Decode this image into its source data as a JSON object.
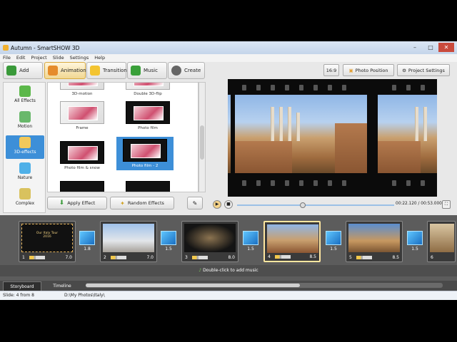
{
  "window": {
    "title": "Autumn - SmartSHOW 3D",
    "controls": [
      "–",
      "□",
      "✕"
    ]
  },
  "menu": [
    "File",
    "Edit",
    "Project",
    "Slide",
    "Settings",
    "Help"
  ],
  "tabs": [
    {
      "label": "Add",
      "icon": "add-icon"
    },
    {
      "label": "Animation",
      "icon": "animation-icon",
      "active": true
    },
    {
      "label": "Transitions",
      "icon": "star-icon"
    },
    {
      "label": "Music",
      "icon": "music-note-icon"
    },
    {
      "label": "Create",
      "icon": "film-reel-icon"
    }
  ],
  "categories": [
    {
      "label": "All Effects",
      "icon": "puzzle-icon"
    },
    {
      "label": "Motion",
      "icon": "move-arrows-icon"
    },
    {
      "label": "3D-effects",
      "icon": "cube-icon",
      "active": true
    },
    {
      "label": "Nature",
      "icon": "snowflake-icon"
    },
    {
      "label": "Complex",
      "icon": "layers-icon"
    }
  ],
  "effects": [
    {
      "label": "3D-motion"
    },
    {
      "label": "Double 3D-flip"
    },
    {
      "label": "Frame"
    },
    {
      "label": "Photo film"
    },
    {
      "label": "Photo film & snow"
    },
    {
      "label": "Photo film - 2",
      "selected": true
    }
  ],
  "actions": {
    "apply": "Apply Effect",
    "random": "Random Effects"
  },
  "right_toolbar": {
    "aspect": "16:9",
    "photo_position": "Photo Position",
    "project_settings": "Project Settings"
  },
  "player": {
    "time": "00:22.120 / 00:53.000",
    "progress": 0.42
  },
  "slides": [
    {
      "num": "1",
      "dur": "7.0",
      "caption": "Our Italy Tour\n2016"
    },
    {
      "num": "2",
      "dur": "7.0"
    },
    {
      "num": "3",
      "dur": "8.0"
    },
    {
      "num": "4",
      "dur": "8.5",
      "active": true
    },
    {
      "num": "5",
      "dur": "8.5"
    },
    {
      "num": "6",
      "dur": ""
    }
  ],
  "transitions": [
    "1.8",
    "1.5",
    "1.5",
    "1.5",
    "1.5"
  ],
  "music_hint": "Double-click to add music",
  "view_tabs": [
    {
      "label": "Storyboard",
      "active": true
    },
    {
      "label": "Timeline"
    }
  ],
  "status": {
    "slide": "Slide: 4 from 8",
    "path": "D:\\My Photos\\Italy\\"
  },
  "colors": {
    "accent": "#3d8fd8",
    "active_tab": "#f1d792",
    "storyboard_bg": "#5c5c5c"
  }
}
